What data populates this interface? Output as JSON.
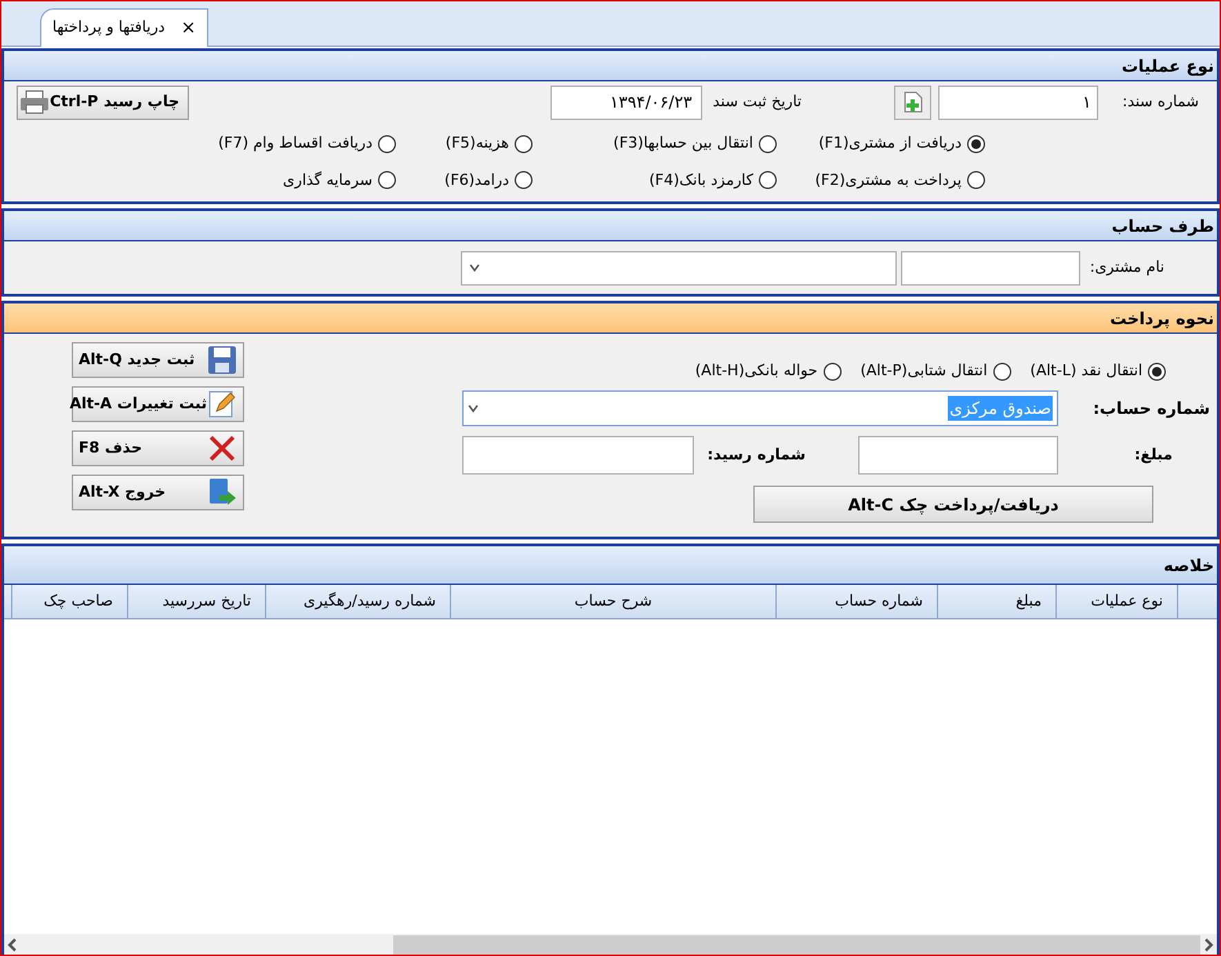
{
  "tab": {
    "label": "دریافتها و پرداختها",
    "close": "×",
    "selected": true
  },
  "operation_type": {
    "title": "نوع عملیات",
    "doc_number": {
      "label": "شماره سند:",
      "value": "۱"
    },
    "doc_date": {
      "label": "تاریخ ثبت سند",
      "value": "۱۳۹۴/۰۶/۲۳"
    },
    "print_button": {
      "label": "چاپ رسید Ctrl-P"
    },
    "options": [
      {
        "label": "دریافت از مشتری(F1)",
        "selected": true
      },
      {
        "label": "انتقال بین حسابها(F3)",
        "selected": false
      },
      {
        "label": "هزینه(F5)",
        "selected": false
      },
      {
        "label": "دریافت اقساط وام (F7)",
        "selected": false
      },
      {
        "label": "پرداخت به مشتری(F2)",
        "selected": false
      },
      {
        "label": "کارمزد بانک(F4)",
        "selected": false
      },
      {
        "label": "درامد(F6)",
        "selected": false
      },
      {
        "label": "سرمایه گذاری",
        "selected": false
      }
    ]
  },
  "account_party": {
    "title": "طرف حساب",
    "customer_label": "نام مشتری:"
  },
  "payment_method": {
    "title": "نحوه پرداخت",
    "options": [
      {
        "label": "انتقال نقد (Alt-L)",
        "selected": true
      },
      {
        "label": "انتقال شتابی(Alt-P)",
        "selected": false
      },
      {
        "label": "حواله بانکی(Alt-H)",
        "selected": false
      }
    ],
    "account": {
      "label": "شماره حساب:",
      "value": "صندوق مرکزی",
      "text_selected": true
    },
    "amount": {
      "label": "مبلغ:"
    },
    "receipt": {
      "label": "شماره رسید:"
    },
    "check_button": {
      "label": "دریافت/پرداخت چک Alt-C"
    },
    "actions": [
      {
        "kind": "save",
        "label": "ثبت جدید Alt-Q"
      },
      {
        "kind": "edit",
        "label": "ثبت تغییرات Alt-A"
      },
      {
        "kind": "delete",
        "label": "حذف F8"
      },
      {
        "kind": "exit",
        "label": "خروج Alt-X"
      }
    ]
  },
  "summary": {
    "title": "خلاصه",
    "columns": [
      "نوع عملیات",
      "مبلغ",
      "شماره حساب",
      "شرح حساب",
      "شماره رسید/رهگیری",
      "تاریخ سررسید",
      "صاحب چک"
    ]
  }
}
